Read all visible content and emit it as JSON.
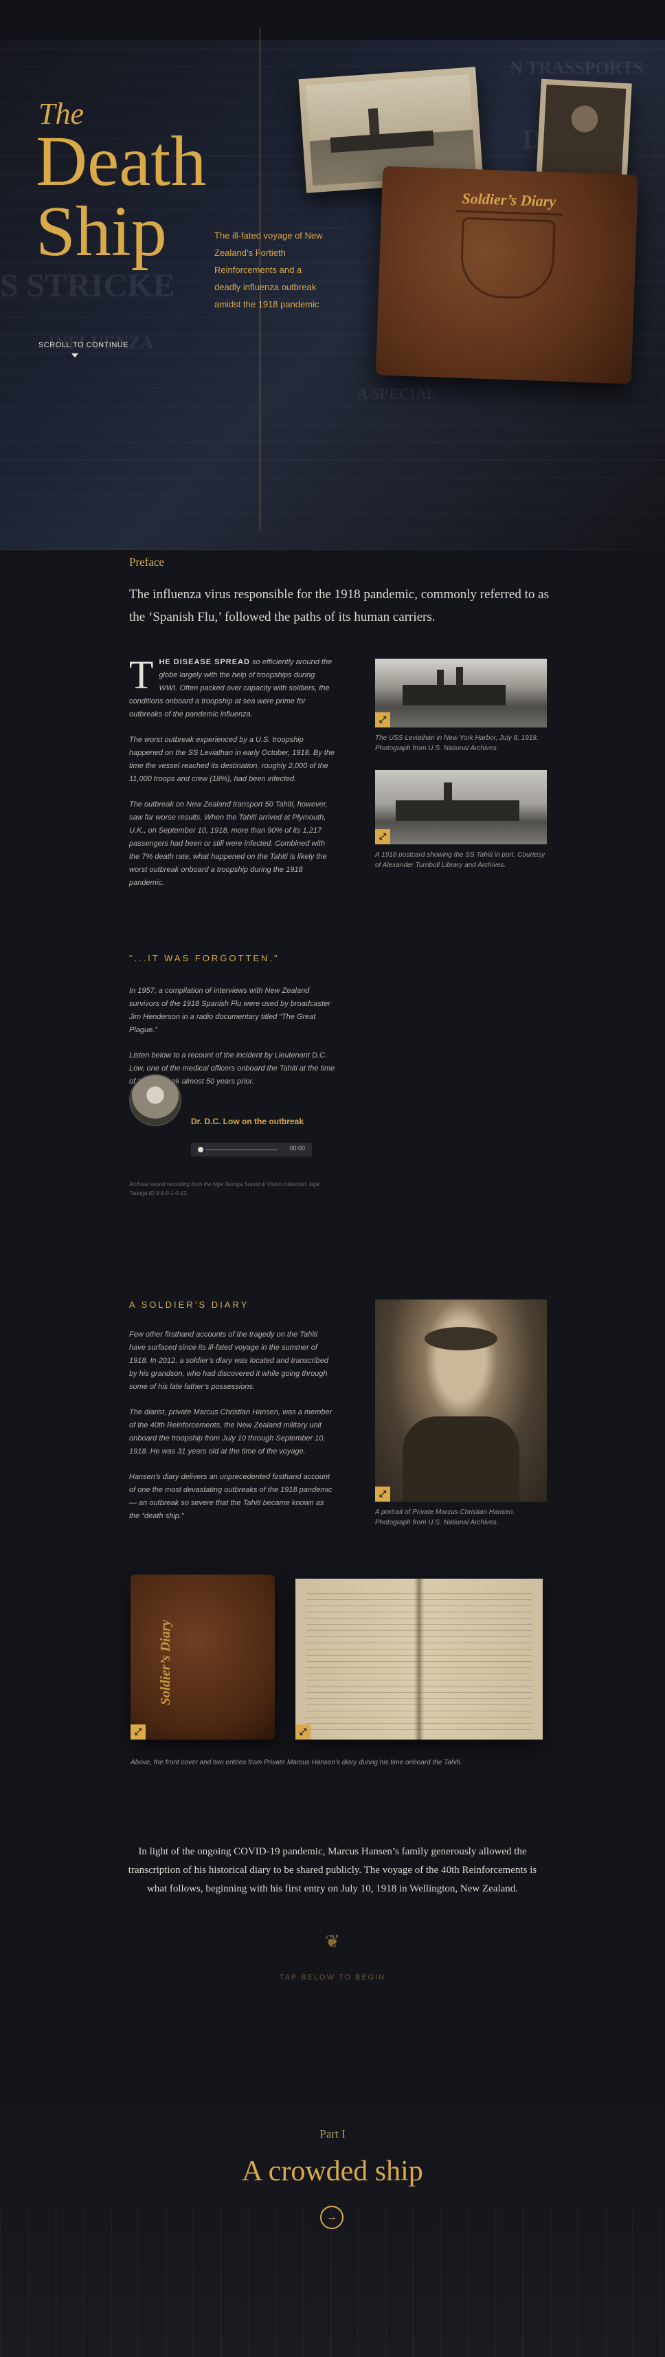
{
  "hero": {
    "title_the": "The",
    "title_line1": "Death",
    "title_line2": "Ship",
    "subtitle": "The ill-fated voyage of New Zealand’s Fortieth Reinforcements and a deadly influenza outbreak amidst the 1918 pandemic",
    "scroll_cta": "SCROLL TO CONTINUE",
    "diary_label": "Soldier’s Diary",
    "newsprint": [
      "N TRASSPORTS",
      "DEA",
      "S STRICKE",
      "INFLUENZA",
      "A SPECIAL"
    ]
  },
  "preface": {
    "label": "Preface",
    "lead": "The influenza virus responsible for the 1918 pandemic, commonly referred to as the ‘Spanish Flu,’ followed the paths of its human carriers.",
    "dropcap": "T",
    "p1_smallcaps": "HE DISEASE SPREAD",
    "p1_rest": " so efficiently around the globe largely with the help of troopships during WWI. Often packed over capacity with soldiers, the conditions onboard a troopship at sea were prime for outbreaks of the pandemic influenza.",
    "p2": "The worst outbreak experienced by a U.S. troopship happened on the SS Leviathan in early October, 1918. By the time the vessel reached its destination, roughly 2,000 of the 11,000 troops and crew (18%), had been infected.",
    "p3": "The outbreak on New Zealand transport 50 Tahiti, however, saw far worse results. When the Tahiti arrived at Plymouth, U.K., on September 10, 1918, more than 90% of its 1,217 passengers had been or still were infected. Combined with the 7% death rate, what happened on the Tahiti is likely the worst outbreak onboard a troopship during the 1918 pandemic.",
    "fig1_caption": "The USS Leviathan in New York Harbor, July 8, 1918. Photograph from U.S. National Archives.",
    "fig2_caption": "A 1918 postcard showing the SS Tahiti in port. Courtesy of Alexander Turnbull Library and Archives."
  },
  "forgotten": {
    "kicker": "“...IT WAS FORGOTTEN.”",
    "p1": "In 1957, a compilation of interviews with New Zealand survivors of the 1918 Spanish Flu were used by broadcaster Jim Henderson in a radio documentary titled “The Great Plague.”",
    "p2": "Listen below to a recount of the incident by Lieutenant D.C. Low, one of the medical officers onboard the Tahiti at the time of the outbreak almost 50 years prior.",
    "audio_title": "Dr. D.C. Low on the outbreak",
    "audio_time": "00:00",
    "audio_note": "Archival sound recording from the Ngā Taonga Sound & Vision collection. Ngā Taonga ID 9-8-0-1-0-12."
  },
  "soldier_diary": {
    "kicker": "A SOLDIER’S DIARY",
    "p1": "Few other firsthand accounts of the tragedy on the Tahiti have surfaced since its ill-fated voyage in the summer of 1918. In 2012, a soldier’s diary was located and transcribed by his grandson, who had discovered it while going through some of his late father’s possessions.",
    "p2": "The diarist, private Marcus Christian Hansen, was a member of the 40th Reinforcements, the New Zealand military unit onboard the troopship from July 10 through September 10, 1918. He was 31 years old at the time of the voyage.",
    "p3": "Hansen’s diary delivers an unprecedented firsthand account of one the most devastating outbreaks of the 1918 pandemic — an outbreak so severe that the Tahiti became known as the “death ship.”",
    "portrait_caption": "A portrait of Private Marcus Christian Hansen. Photograph from U.S. National Archives.",
    "spine_label": "Soldier’s Diary",
    "diary_caption": "Above, the front cover and two entries from Private Marcus Hansen’s diary during his time onboard the Tahiti."
  },
  "intro": {
    "covid_text": "In light of the ongoing COVID-19 pandemic, Marcus Hansen’s family generously allowed the transcription of his historical diary to be shared publicly. The voyage of the 40th Reinforcements is what follows, beginning with his first entry on July 10, 1918 in Wellington, New Zealand.",
    "ornament": "❦",
    "tap_below": "TAP BELOW TO BEGIN"
  },
  "part": {
    "label": "Part I",
    "title": "A crowded ship",
    "button_glyph": "→"
  },
  "icons": {
    "expand": "⤢"
  },
  "colors": {
    "accent": "#d9a94a",
    "background": "#14151b"
  }
}
